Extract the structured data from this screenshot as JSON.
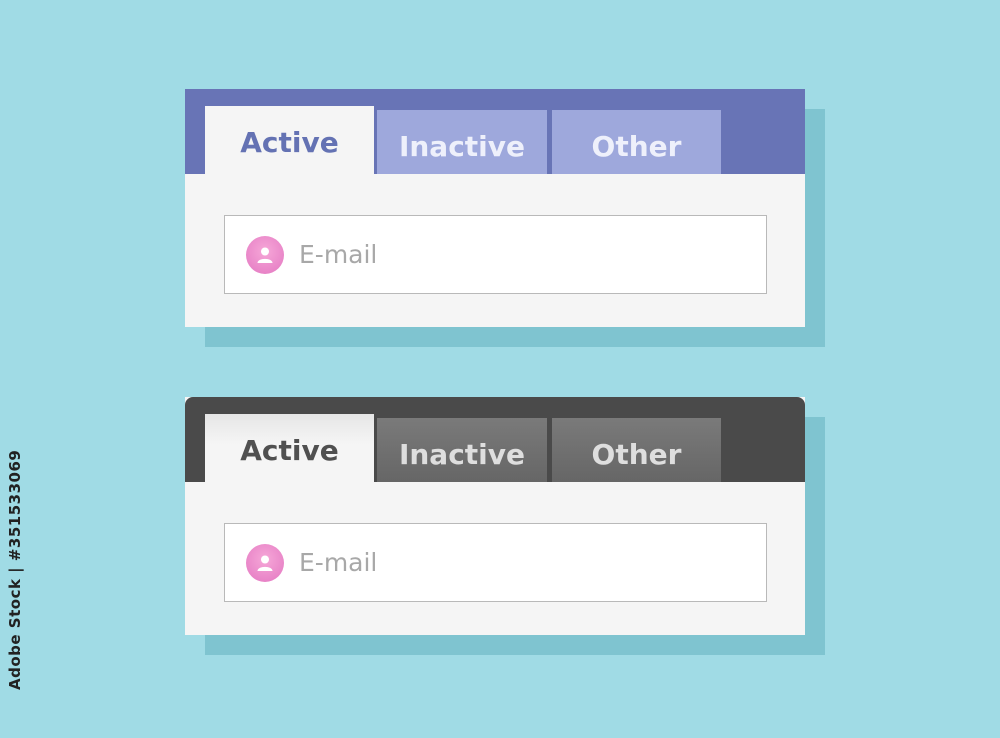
{
  "colors": {
    "background": "#a0dbe5",
    "blue_header": "#6874b6",
    "blue_active_text": "#6472b3",
    "blue_inactive_tab": "#9ea8dc",
    "dark_header": "#4a4a4a",
    "dark_inactive_tab": "#707070",
    "panel_body": "#f5f5f5",
    "avatar_pink": "#ee8fcc"
  },
  "panels": [
    {
      "theme": "blue",
      "tabs": [
        {
          "label": "Active",
          "state": "active"
        },
        {
          "label": "Inactive",
          "state": "inactive"
        },
        {
          "label": "Other",
          "state": "inactive"
        }
      ],
      "email_field": {
        "icon": "user-icon",
        "placeholder": "E-mail"
      }
    },
    {
      "theme": "dark",
      "tabs": [
        {
          "label": "Active",
          "state": "active"
        },
        {
          "label": "Inactive",
          "state": "inactive"
        },
        {
          "label": "Other",
          "state": "inactive"
        }
      ],
      "email_field": {
        "icon": "user-icon",
        "placeholder": "E-mail"
      }
    }
  ],
  "watermark": {
    "text": "Adobe Stock | #351533069"
  }
}
